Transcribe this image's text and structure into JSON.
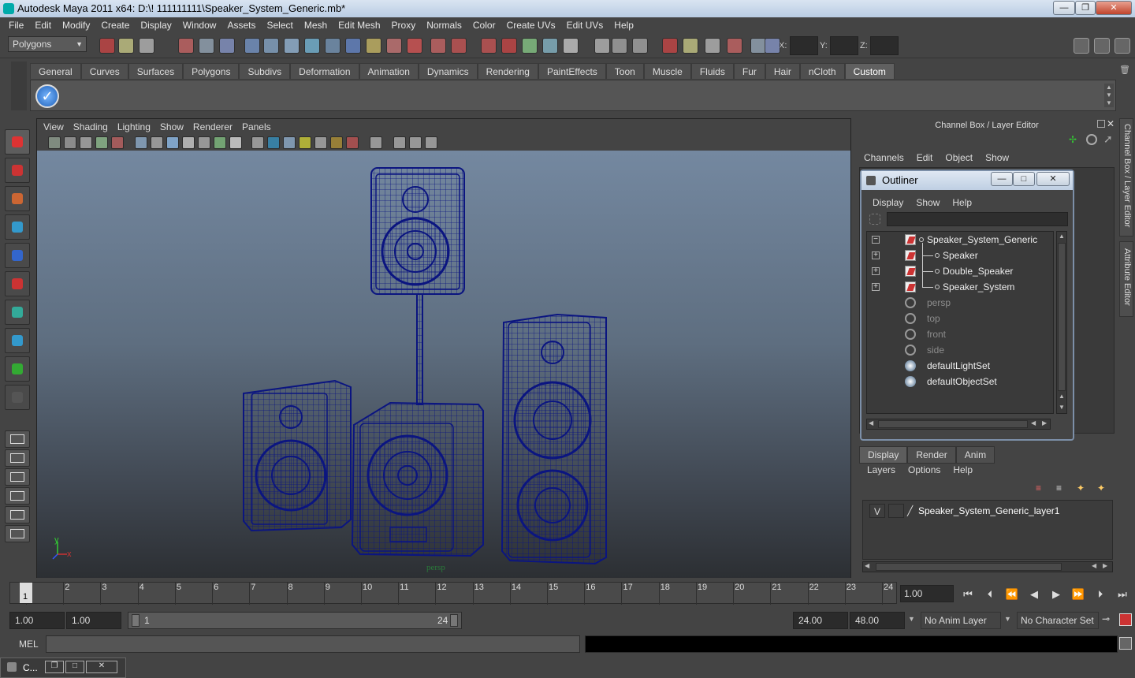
{
  "window": {
    "title": "Autodesk Maya 2011 x64: D:\\! 111111111\\Speaker_System_Generic.mb*",
    "minimize": "—",
    "maximize": "❐",
    "close": "✕"
  },
  "menubar": [
    "File",
    "Edit",
    "Modify",
    "Create",
    "Display",
    "Window",
    "Assets",
    "Select",
    "Mesh",
    "Edit Mesh",
    "Proxy",
    "Normals",
    "Color",
    "Create UVs",
    "Edit UVs",
    "Help"
  ],
  "status": {
    "mode": "Polygons",
    "x_label": "X:",
    "y_label": "Y:",
    "z_label": "Z:"
  },
  "shelf_tabs": [
    "General",
    "Curves",
    "Surfaces",
    "Polygons",
    "Subdivs",
    "Deformation",
    "Animation",
    "Dynamics",
    "Rendering",
    "PaintEffects",
    "Toon",
    "Muscle",
    "Fluids",
    "Fur",
    "Hair",
    "nCloth",
    "Custom"
  ],
  "shelf_active": "Custom",
  "panel_menu": [
    "View",
    "Shading",
    "Lighting",
    "Show",
    "Renderer",
    "Panels"
  ],
  "viewport": {
    "camera_label": "persp",
    "axis_y": "y",
    "axis_x": "x",
    "wire_color": "#0b1580"
  },
  "channel_box": {
    "title": "Channel Box / Layer Editor",
    "menu": [
      "Channels",
      "Edit",
      "Object",
      "Show"
    ],
    "side_tab_1": "Channel Box / Layer Editor",
    "side_tab_2": "Attribute Editor"
  },
  "outliner": {
    "title": "Outliner",
    "menu": [
      "Display",
      "Show",
      "Help"
    ],
    "items": [
      {
        "label": "Speaker_System_Generic",
        "type": "transform",
        "indent": 0,
        "expand": "−",
        "dim": false
      },
      {
        "label": "Speaker",
        "type": "transform",
        "indent": 1,
        "expand": "+",
        "dim": false
      },
      {
        "label": "Double_Speaker",
        "type": "transform",
        "indent": 1,
        "expand": "+",
        "dim": false
      },
      {
        "label": "Speaker_System",
        "type": "transform",
        "indent": 1,
        "expand": "+",
        "dim": false
      },
      {
        "label": "persp",
        "type": "camera",
        "indent": 0,
        "expand": "",
        "dim": true
      },
      {
        "label": "top",
        "type": "camera",
        "indent": 0,
        "expand": "",
        "dim": true
      },
      {
        "label": "front",
        "type": "camera",
        "indent": 0,
        "expand": "",
        "dim": true
      },
      {
        "label": "side",
        "type": "camera",
        "indent": 0,
        "expand": "",
        "dim": true
      },
      {
        "label": "defaultLightSet",
        "type": "set",
        "indent": 0,
        "expand": "",
        "dim": false
      },
      {
        "label": "defaultObjectSet",
        "type": "set",
        "indent": 0,
        "expand": "",
        "dim": false
      }
    ]
  },
  "layer_editor": {
    "tabs": [
      "Display",
      "Render",
      "Anim"
    ],
    "active_tab": "Display",
    "menu": [
      "Layers",
      "Options",
      "Help"
    ],
    "layer": {
      "visible": "V",
      "name": "Speaker_System_Generic_layer1"
    }
  },
  "timeline": {
    "ticks": [
      "1",
      "2",
      "3",
      "4",
      "5",
      "6",
      "7",
      "8",
      "9",
      "10",
      "11",
      "12",
      "13",
      "14",
      "15",
      "16",
      "17",
      "18",
      "19",
      "20",
      "21",
      "22",
      "23",
      "24"
    ],
    "current_marker": "1",
    "current_frame": "1.00"
  },
  "range": {
    "start_a": "1.00",
    "start_b": "1.00",
    "slider_start": "1",
    "slider_end": "24",
    "end_a": "24.00",
    "end_b": "48.00",
    "anim_layer": "No Anim Layer",
    "char_set": "No Character Set"
  },
  "mel": {
    "label": "MEL"
  },
  "taskbar": {
    "label": "C..."
  }
}
